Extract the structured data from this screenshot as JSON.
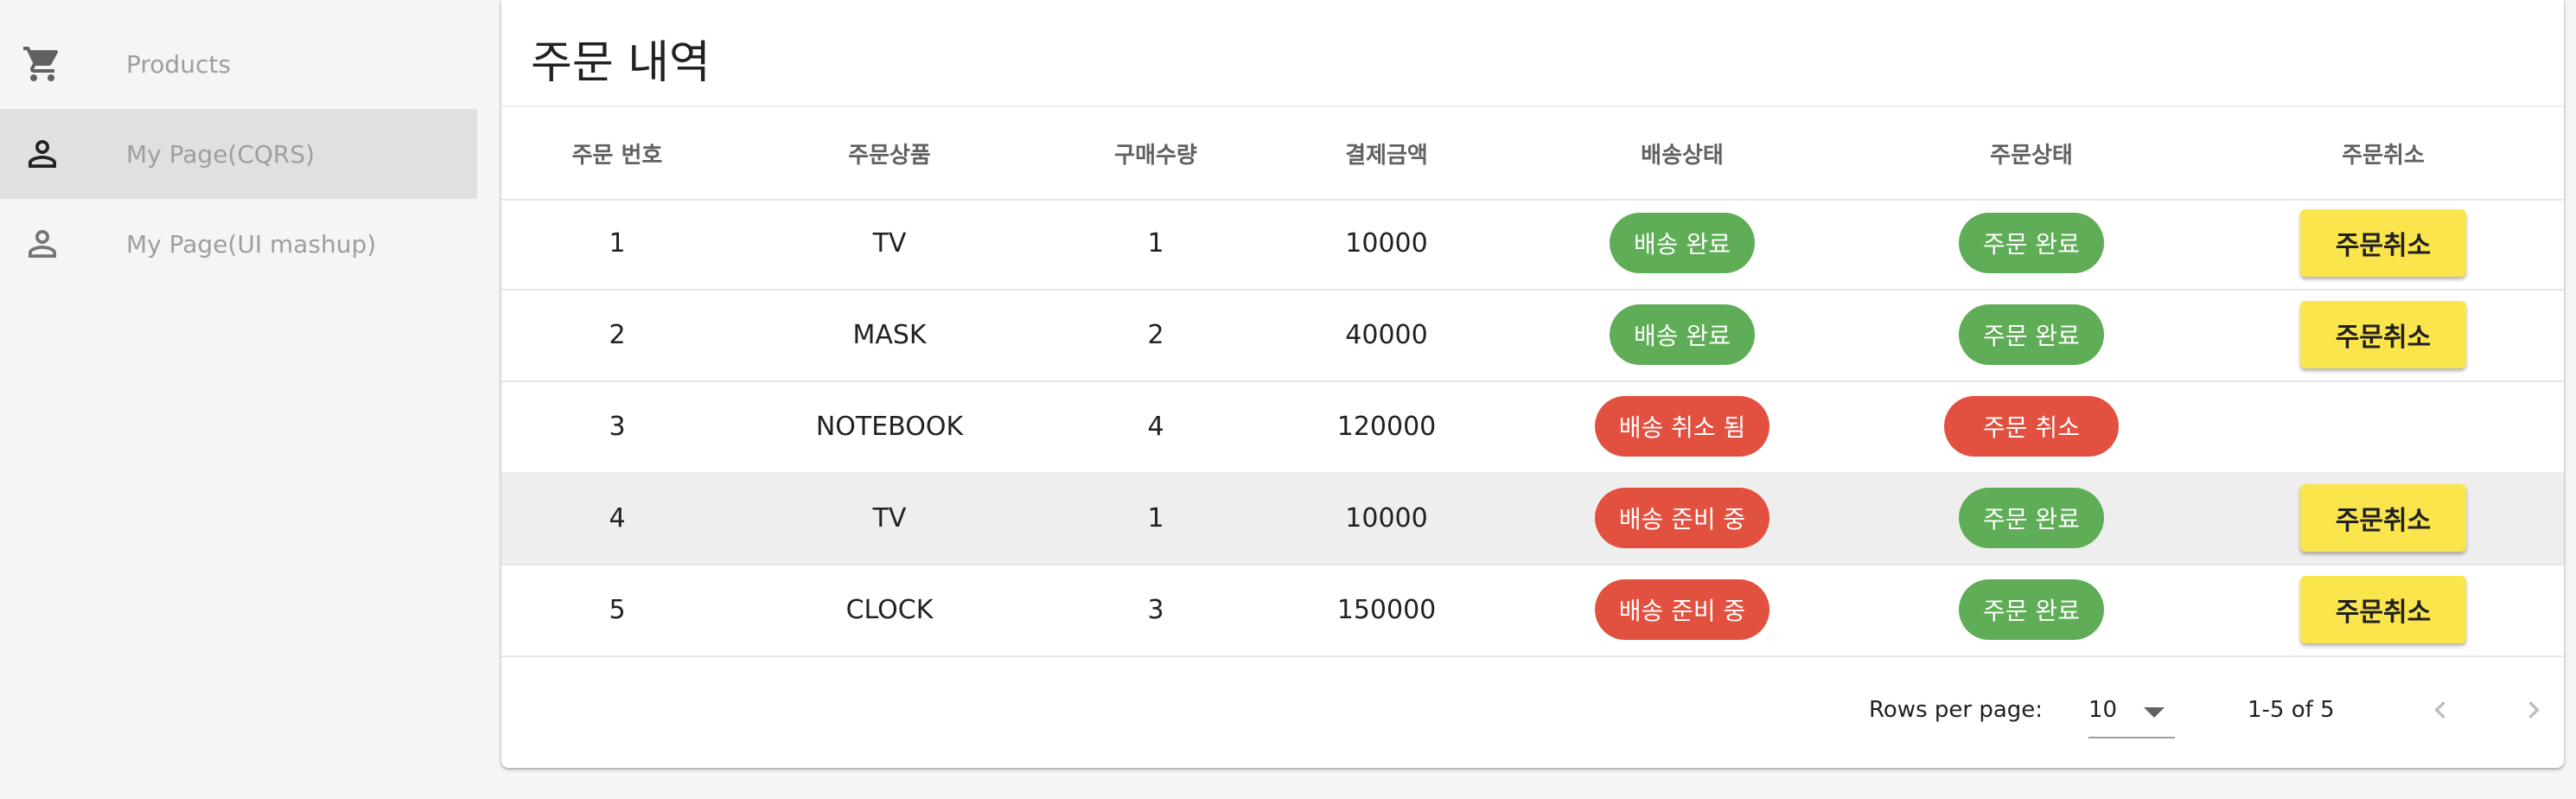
{
  "sidebar": {
    "items": [
      {
        "label": "Products",
        "icon": "cart-icon"
      },
      {
        "label": "My Page(CQRS)",
        "icon": "person-icon",
        "active": true
      },
      {
        "label": "My Page(UI mashup)",
        "icon": "person-icon"
      }
    ]
  },
  "main": {
    "title": "주문 내역",
    "columns": [
      "주문 번호",
      "주문상품",
      "구매수량",
      "결제금액",
      "배송상태",
      "주문상태",
      "주문취소"
    ],
    "rows": [
      {
        "id": "1",
        "product": "TV",
        "qty": "1",
        "amount": "10000",
        "delivery": "배송 완료",
        "order": "주문 완료",
        "cancel": "주문취소"
      },
      {
        "id": "2",
        "product": "MASK",
        "qty": "2",
        "amount": "40000",
        "delivery": "배송 완료",
        "order": "주문 완료",
        "cancel": "주문취소"
      },
      {
        "id": "3",
        "product": "NOTEBOOK",
        "qty": "4",
        "amount": "120000",
        "delivery": "배송 취소 됨",
        "order": "주문 취소",
        "cancel": ""
      },
      {
        "id": "4",
        "product": "TV",
        "qty": "1",
        "amount": "10000",
        "delivery": "배송 준비 중",
        "order": "주문 완료",
        "cancel": "주문취소"
      },
      {
        "id": "5",
        "product": "CLOCK",
        "qty": "3",
        "amount": "150000",
        "delivery": "배송 준비 중",
        "order": "주문 완료",
        "cancel": "주문취소"
      }
    ],
    "pagination": {
      "rows_per_page_label": "Rows per page:",
      "rows_per_page": "10",
      "range": "1-5 of 5"
    }
  },
  "colors": {
    "chip_success": "#5fad56",
    "chip_error": "#e25040",
    "cancel_button": "#fbe54c",
    "active_nav": "#e0e0e0"
  }
}
